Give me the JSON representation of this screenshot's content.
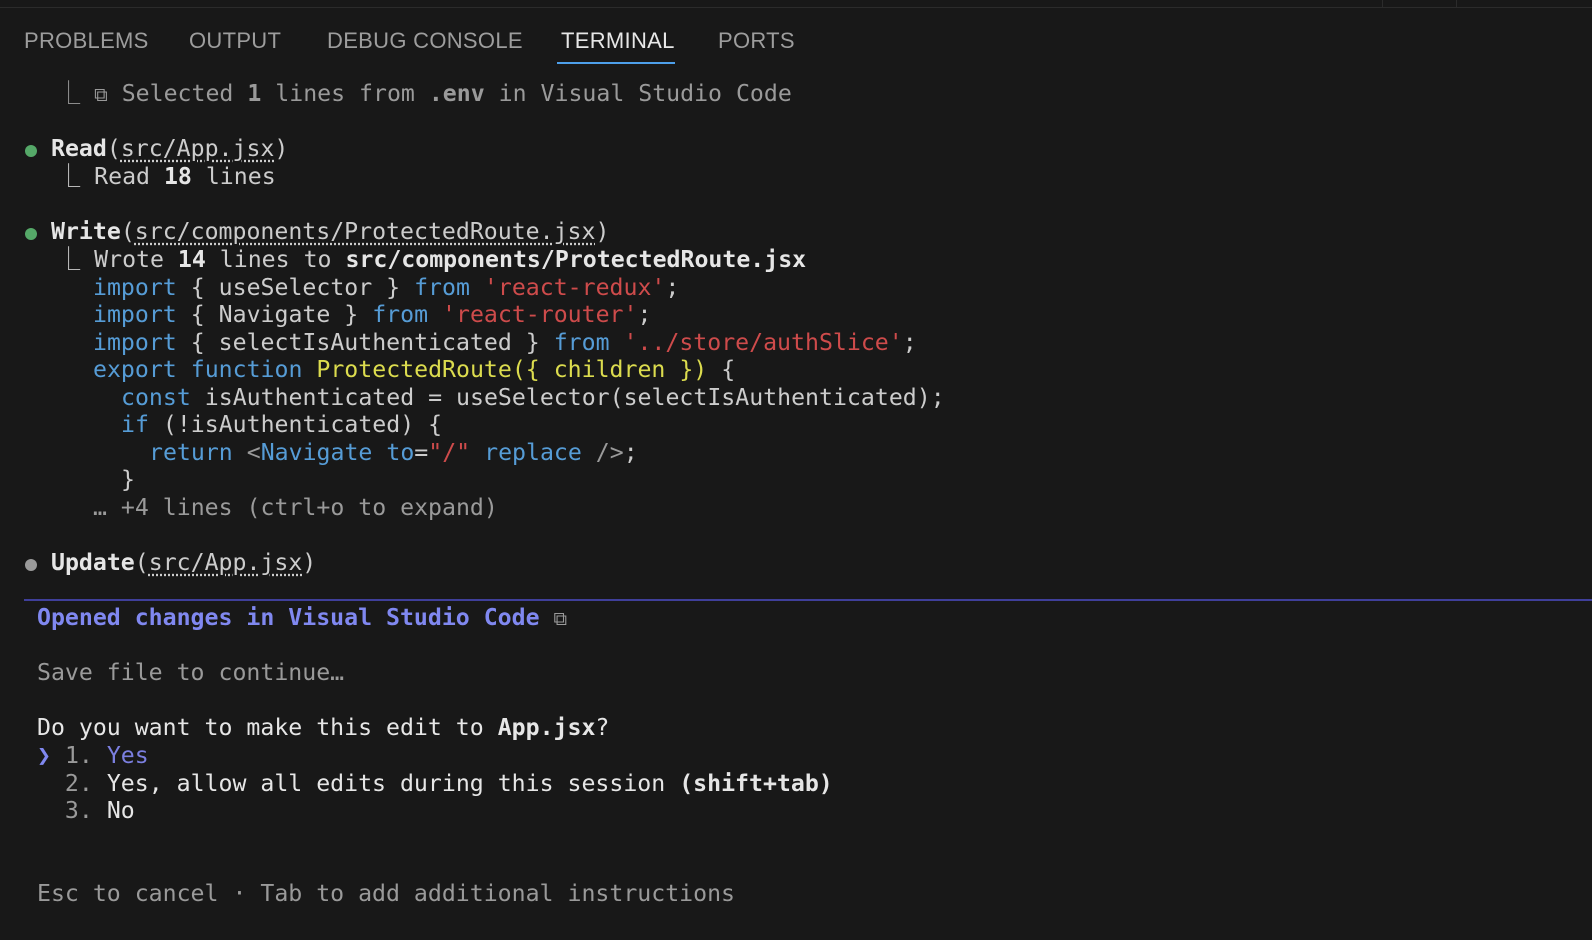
{
  "tabs": [
    {
      "label": "PROBLEMS"
    },
    {
      "label": "OUTPUT"
    },
    {
      "label": "DEBUG CONSOLE"
    },
    {
      "label": "TERMINAL"
    },
    {
      "label": "PORTS"
    }
  ],
  "active_tab": "TERMINAL",
  "terminal": {
    "selected_line": {
      "corner": "⎿",
      "icon": "⧉",
      "pre": "Selected ",
      "count": "1",
      "mid": " lines from ",
      "file": ".env",
      "post": " in Visual Studio Code"
    },
    "read_action": {
      "tool": "Read",
      "open": "(",
      "path": "src/App.jsx",
      "close": ")",
      "result_pre": "Read ",
      "result_count": "18",
      "result_post": " lines"
    },
    "write_action": {
      "tool": "Write",
      "open": "(",
      "path": "src/components/ProtectedRoute.jsx",
      "close": ")",
      "result_pre": "Wrote ",
      "result_count": "14",
      "result_mid": " lines to ",
      "result_path": "src/components/ProtectedRoute.jsx"
    },
    "code": {
      "l1": {
        "kw": "import",
        "a": " { useSelector } ",
        "from": "from",
        "sp": " ",
        "str": "'react-redux'",
        "end": ";"
      },
      "l2": {
        "kw": "import",
        "a": " { Navigate } ",
        "from": "from",
        "sp": " ",
        "str": "'react-router'",
        "end": ";"
      },
      "l3": {
        "kw": "import",
        "a": " { selectIsAuthenticated } ",
        "from": "from",
        "sp": " ",
        "str": "'../store/authSlice'",
        "end": ";"
      },
      "l4": {
        "kw1": "export",
        "sp1": " ",
        "kw2": "function",
        "sp2": " ",
        "fn": "ProtectedRoute({ children })",
        "end": " {"
      },
      "l5": {
        "kw": "const",
        "rest": " isAuthenticated = useSelector(selectIsAuthenticated);"
      },
      "l6": {
        "kw": "if",
        "rest": " (!isAuthenticated) {"
      },
      "l7": {
        "kw": "return",
        "sp": " ",
        "lt": "<",
        "tag": "Navigate",
        "sp2": " ",
        "attr": "to",
        "eq": "=",
        "val": "\"/\"",
        "sp3": " ",
        "attr2": "replace",
        "close": " />",
        "end": ";"
      },
      "l8": {
        "text": "}"
      },
      "more": "… +4 lines (ctrl+o to expand)"
    },
    "update_action": {
      "tool": "Update",
      "open": "(",
      "path": "src/App.jsx",
      "close": ")"
    },
    "prompt": {
      "opened": "Opened changes in Visual Studio Code",
      "opened_icon": "⧉",
      "save_hint": "Save file to continue…",
      "question_pre": "Do you want to make this edit to ",
      "question_file": "App.jsx",
      "question_post": "?",
      "cursor": "❯",
      "options": [
        {
          "num": "1.",
          "label": "Yes",
          "hint": ""
        },
        {
          "num": "2.",
          "label": "Yes, allow all edits during this session ",
          "hint": "(shift+tab)"
        },
        {
          "num": "3.",
          "label": "No",
          "hint": ""
        }
      ],
      "footer": "Esc to cancel · Tab to add additional instructions"
    }
  },
  "colors": {
    "background": "#181818",
    "active_tab_underline": "#4d9fea",
    "success_bullet": "#55a868",
    "pending_bullet": "#9a9a9a",
    "prompt_accent": "#8088f0",
    "keyword": "#569cd6",
    "string": "#ce4b4b",
    "function": "#dcdc4e"
  }
}
